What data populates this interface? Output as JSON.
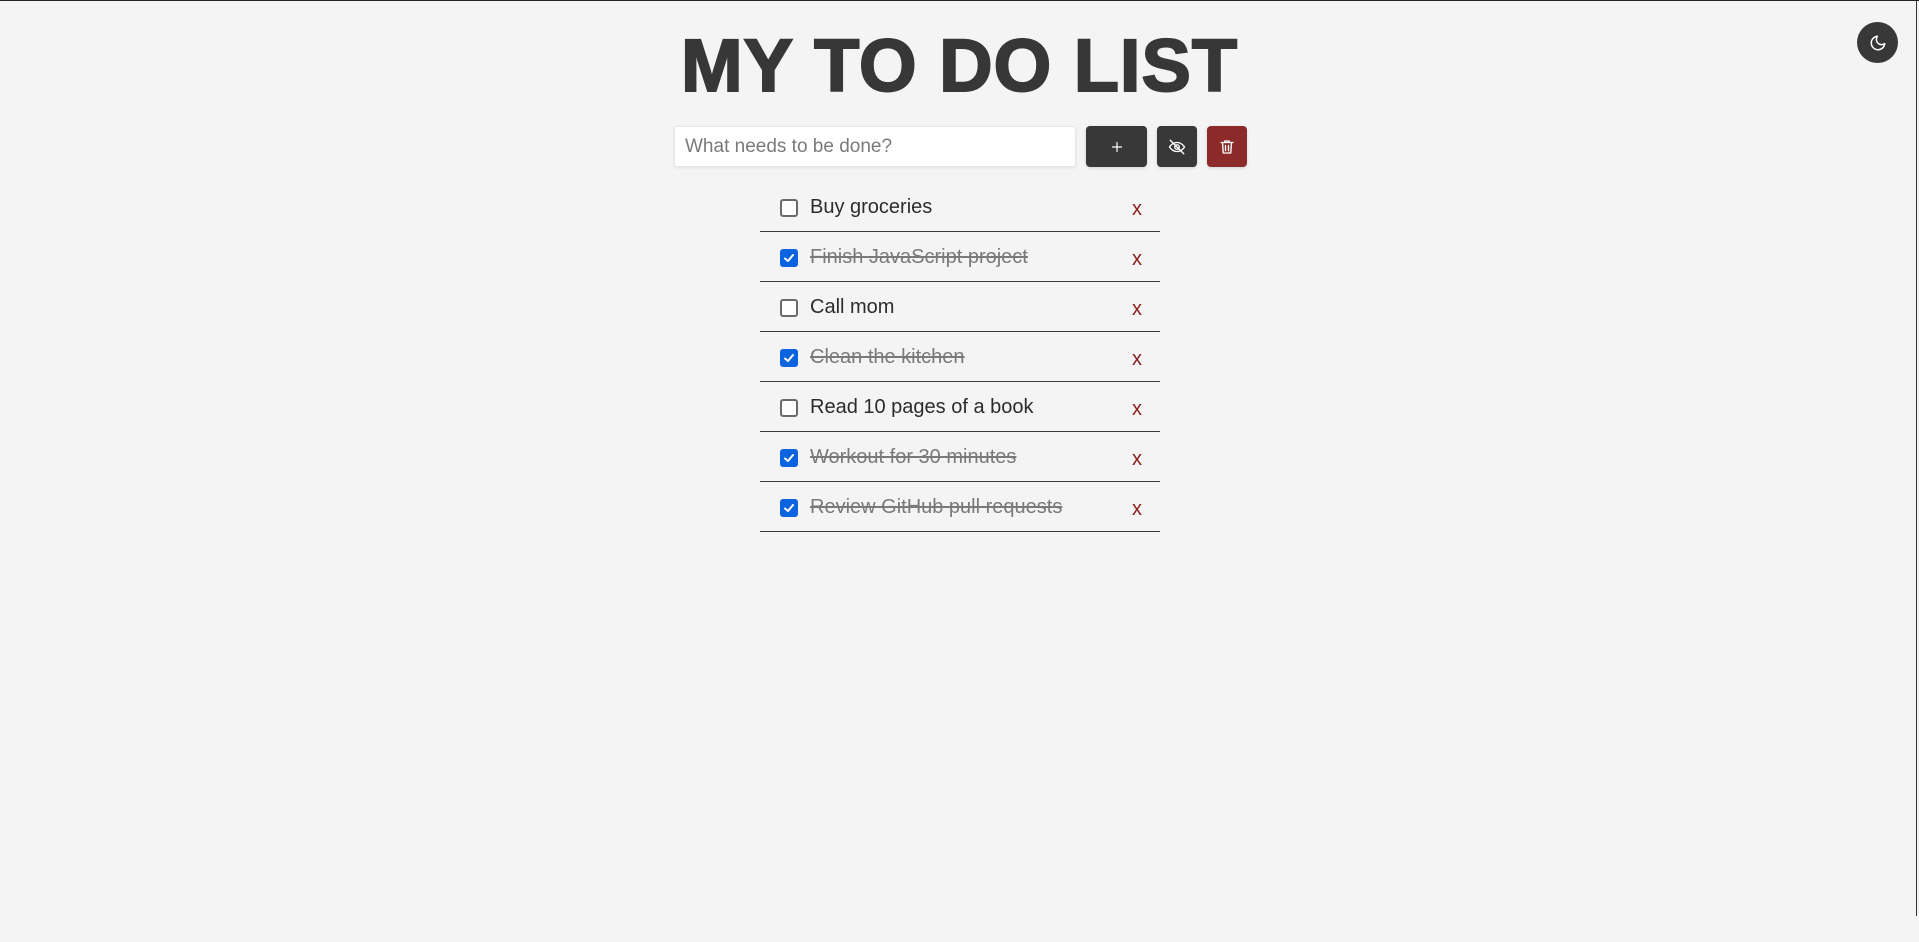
{
  "header": {
    "title": "MY TO DO LIST"
  },
  "theme_toggle": {
    "icon": "moon-icon"
  },
  "controls": {
    "input_placeholder": "What needs to be done?",
    "input_value": "",
    "add_icon": "plus-icon",
    "hide_icon": "eye-off-icon",
    "clear_icon": "trash-icon"
  },
  "todos": [
    {
      "text": "Buy groceries",
      "done": false,
      "delete_label": "x"
    },
    {
      "text": "Finish JavaScript project",
      "done": true,
      "delete_label": "x"
    },
    {
      "text": "Call mom",
      "done": false,
      "delete_label": "x"
    },
    {
      "text": "Clean the kitchen",
      "done": true,
      "delete_label": "x"
    },
    {
      "text": "Read 10 pages of a book",
      "done": false,
      "delete_label": "x"
    },
    {
      "text": "Workout for 30 minutes",
      "done": true,
      "delete_label": "x"
    },
    {
      "text": "Review GitHub pull requests",
      "done": true,
      "delete_label": "x"
    }
  ],
  "colors": {
    "background": "#f4f4f4",
    "dark": "#383838",
    "danger": "#8c2a2a",
    "check_accent": "#0b63e0"
  }
}
